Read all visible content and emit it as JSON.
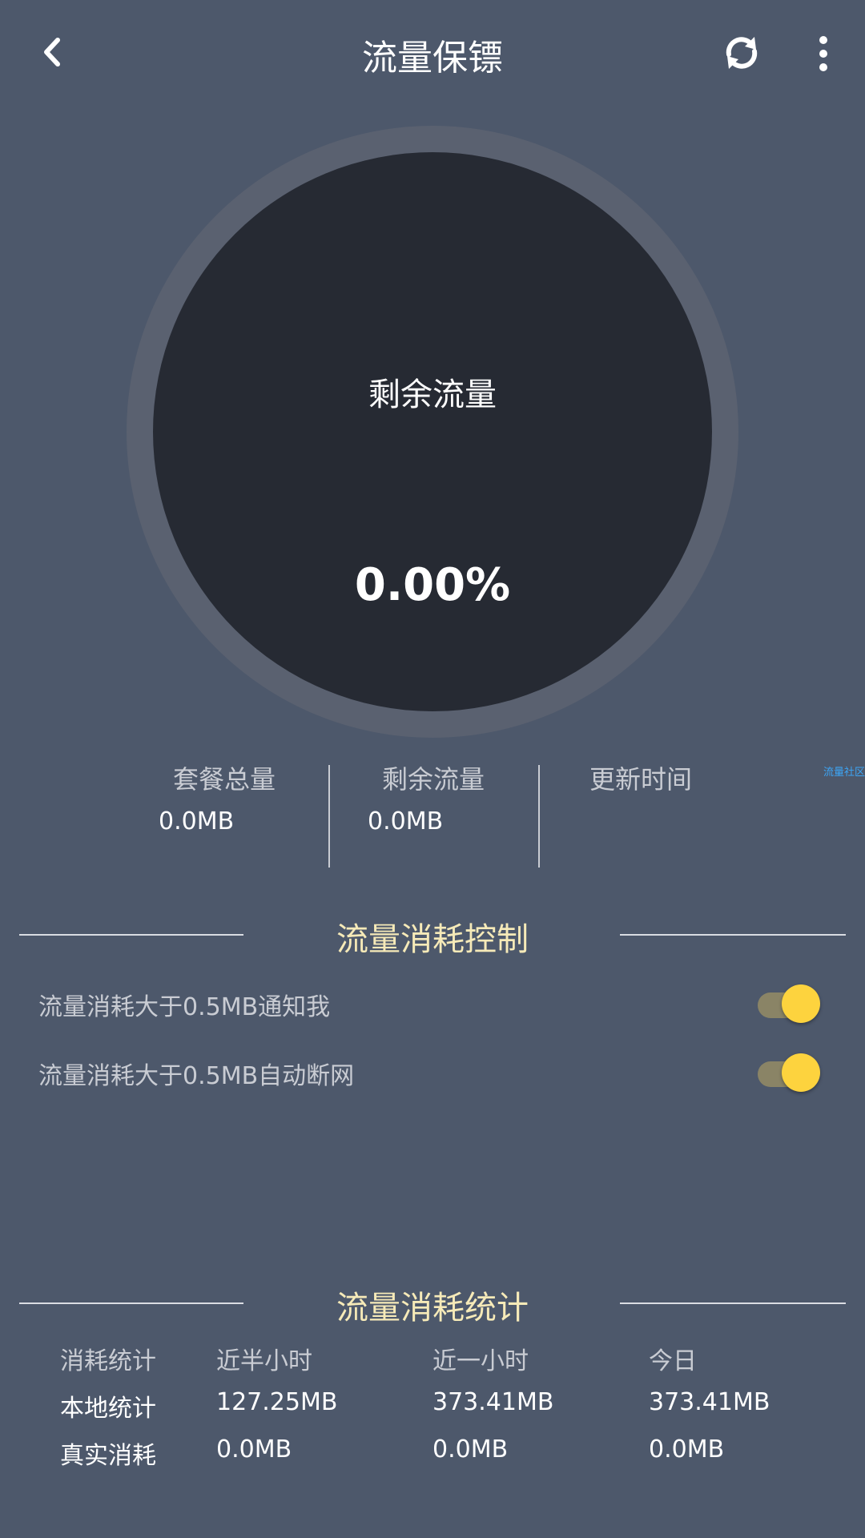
{
  "header": {
    "title": "流量保镖",
    "back_icon": "chevron-left-icon",
    "refresh_icon": "refresh-icon",
    "more_icon": "more-vertical-icon"
  },
  "gauge": {
    "label": "剩余流量",
    "value": "0.00%",
    "remaining_fraction": 0.0
  },
  "summary": {
    "total_label": "套餐总量",
    "total_value": "0.0MB",
    "remaining_label": "剩余流量",
    "remaining_value": "0.0MB",
    "update_label": "更新时间",
    "update_value": ""
  },
  "watermark": "流量社区",
  "control": {
    "title": "流量消耗控制",
    "items": [
      {
        "label": "流量消耗大于0.5MB通知我",
        "enabled": true
      },
      {
        "label": "流量消耗大于0.5MB自动断网",
        "enabled": true
      }
    ]
  },
  "stats": {
    "title": "流量消耗统计",
    "columns": [
      "消耗统计",
      "近半小时",
      "近一小时",
      "今日"
    ],
    "rows": [
      [
        "本地统计",
        "127.25MB",
        "373.41MB",
        "373.41MB"
      ],
      [
        "真实消耗",
        "0.0MB",
        "0.0MB",
        "0.0MB"
      ]
    ]
  },
  "colors": {
    "background": "#4d586b",
    "gauge_disc": "#262a33",
    "accent_title": "#f6eab8",
    "toggle_on": "#fdd33e"
  }
}
